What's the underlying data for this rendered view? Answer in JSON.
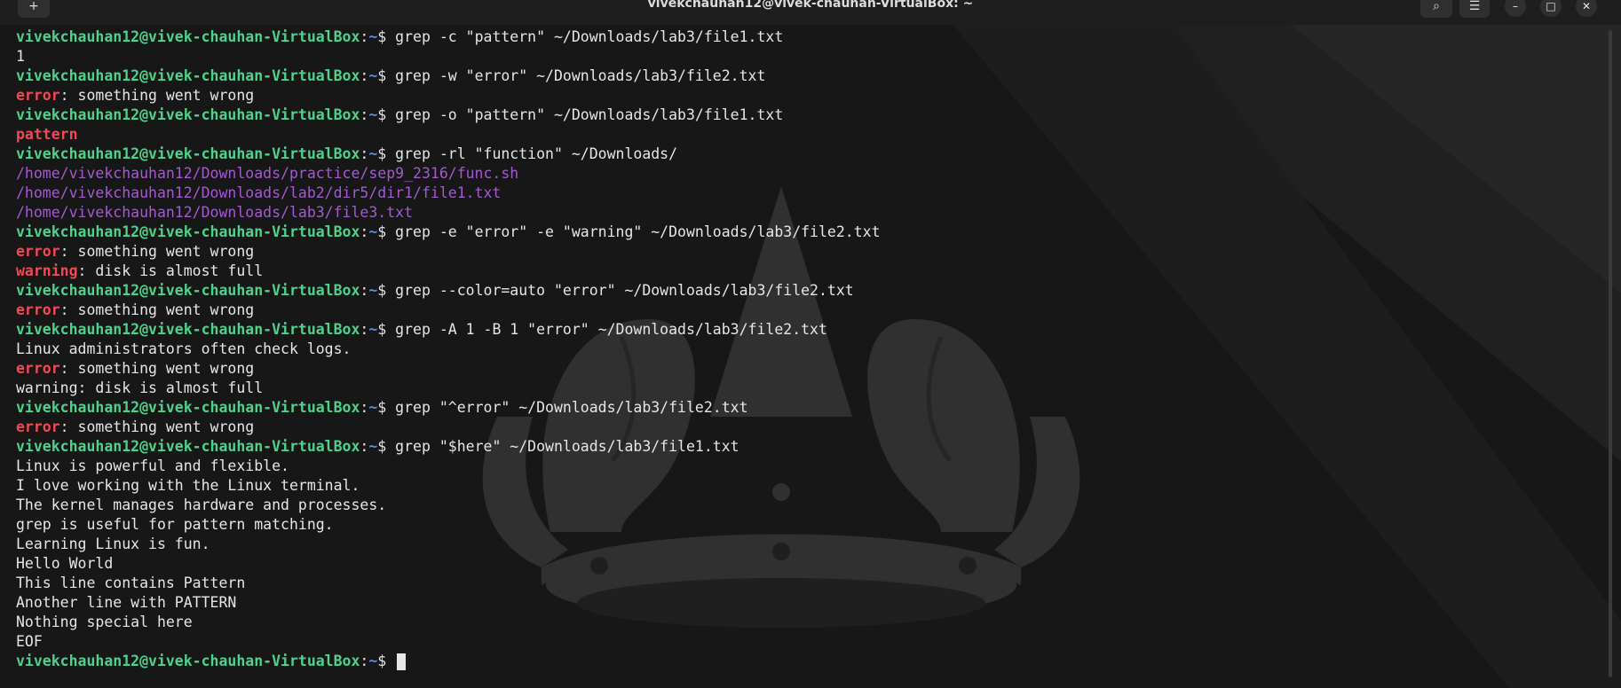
{
  "window": {
    "title": "vivekchauhan12@vivek-chauhan-VirtualBox: ~",
    "new_tab_icon": "+",
    "search_icon": "⌕",
    "menu_icon": "☰",
    "minimize_icon": "–",
    "maximize_icon": "□",
    "close_icon": "✕"
  },
  "prompt": {
    "user_host": "vivekchauhan12@vivek-chauhan-VirtualBox",
    "sep": ":",
    "path": "~",
    "symbol": "$ "
  },
  "lines": [
    {
      "cmd": "grep -c \"pattern\" ~/Downloads/lab3/file1.txt"
    },
    {
      "text": "1"
    },
    {
      "cmd": "grep -w \"error\" ~/Downloads/lab3/file2.txt"
    },
    {
      "match": "error",
      "text": ": something went wrong"
    },
    {
      "cmd": "grep -o \"pattern\" ~/Downloads/lab3/file1.txt"
    },
    {
      "match": "pattern",
      "text": ""
    },
    {
      "cmd": "grep -rl \"function\" ~/Downloads/"
    },
    {
      "path": "/home/vivekchauhan12/Downloads/practice/sep9_2316/func.sh"
    },
    {
      "path": "/home/vivekchauhan12/Downloads/lab2/dir5/dir1/file1.txt"
    },
    {
      "path": "/home/vivekchauhan12/Downloads/lab3/file3.txt"
    },
    {
      "cmd": "grep -e \"error\" -e \"warning\" ~/Downloads/lab3/file2.txt"
    },
    {
      "match": "error",
      "text": ": something went wrong"
    },
    {
      "match": "warning",
      "text": ": disk is almost full"
    },
    {
      "cmd": "grep --color=auto \"error\" ~/Downloads/lab3/file2.txt"
    },
    {
      "match": "error",
      "text": ": something went wrong"
    },
    {
      "cmd": "grep -A 1 -B 1 \"error\" ~/Downloads/lab3/file2.txt"
    },
    {
      "text": "Linux administrators often check logs."
    },
    {
      "match": "error",
      "text": ": something went wrong"
    },
    {
      "text": "warning: disk is almost full"
    },
    {
      "cmd": "grep \"^error\" ~/Downloads/lab3/file2.txt"
    },
    {
      "match": "error",
      "text": ": something went wrong"
    },
    {
      "cmd": "grep \"$here\" ~/Downloads/lab3/file1.txt"
    },
    {
      "text": "Linux is powerful and flexible."
    },
    {
      "text": "I love working with the Linux terminal."
    },
    {
      "text": "The kernel manages hardware and processes."
    },
    {
      "text": "grep is useful for pattern matching."
    },
    {
      "text": "Learning Linux is fun."
    },
    {
      "text": "Hello World"
    },
    {
      "text": "This line contains Pattern"
    },
    {
      "text": "Another line with PATTERN"
    },
    {
      "text": "Nothing special here"
    },
    {
      "text": "EOF"
    },
    {
      "cmd": "",
      "cursor": true
    }
  ]
}
